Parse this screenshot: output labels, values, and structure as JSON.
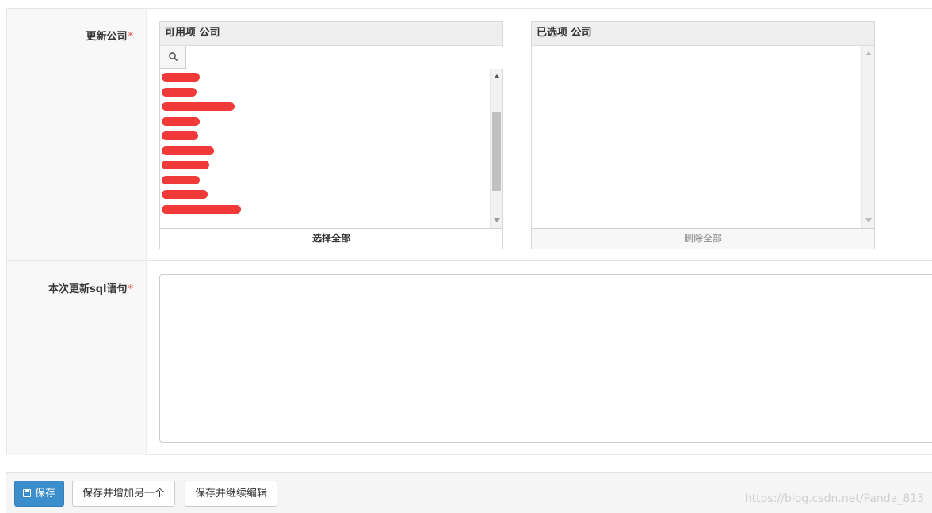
{
  "fields": {
    "companies": {
      "label": "更新公司",
      "required_mark": "*"
    },
    "sql": {
      "label": "本次更新sql语句",
      "required_mark": "*",
      "value": ""
    }
  },
  "available": {
    "title": "可用项 公司",
    "filter_value": "",
    "filter_icon": "search-icon",
    "items": [
      "",
      "",
      "",
      "",
      "",
      "",
      "",
      "",
      "",
      ""
    ],
    "choose_all_label": "选择全部",
    "scroll_position": 0.55
  },
  "chosen": {
    "title": "已选项 公司",
    "items": [],
    "remove_all_label": "删除全部"
  },
  "submit": {
    "save_label": "保存",
    "save_icon": "floppy-disk-icon",
    "save_add_label": "保存并增加另一个",
    "save_continue_label": "保存并继续编辑"
  },
  "watermark": "https://blog.csdn.net/Panda_813",
  "colors": {
    "primary": "#3c8dcb",
    "required": "#d9534f",
    "redaction": "#f03a3a"
  }
}
